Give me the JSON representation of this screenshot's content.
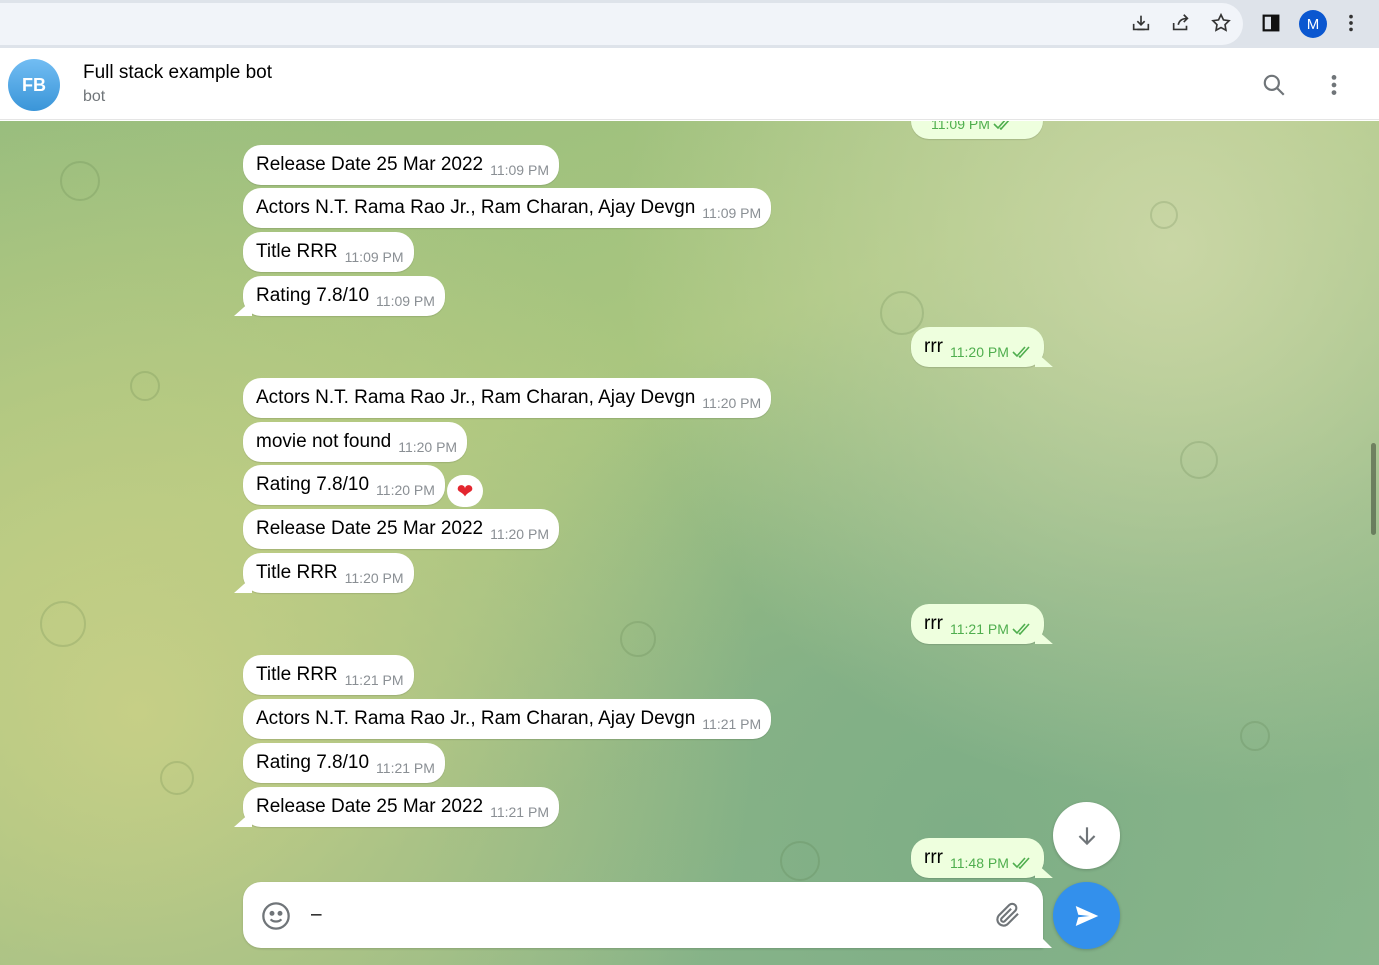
{
  "browser": {
    "profile_initial": "M",
    "icons": [
      "install-icon",
      "share-icon",
      "star-icon",
      "side-panel-icon",
      "kebab-menu-icon"
    ]
  },
  "chat": {
    "avatar_initials": "FB",
    "title": "Full stack example bot",
    "subtitle": "bot"
  },
  "messages": {
    "m0": {
      "time": "11:09 PM"
    },
    "m1": {
      "text": "Release Date 25 Mar 2022",
      "time": "11:09 PM"
    },
    "m2": {
      "text": "Actors N.T. Rama Rao Jr., Ram Charan, Ajay Devgn",
      "time": "11:09 PM"
    },
    "m3": {
      "text": "Title RRR",
      "time": "11:09 PM"
    },
    "m4": {
      "text": "Rating 7.8/10",
      "time": "11:09 PM"
    },
    "m5": {
      "text": "rrr",
      "time": "11:20 PM"
    },
    "m6": {
      "text": "Actors N.T. Rama Rao Jr., Ram Charan, Ajay Devgn",
      "time": "11:20 PM"
    },
    "m7": {
      "text": "movie not found",
      "time": "11:20 PM"
    },
    "m8": {
      "text": "Rating 7.8/10",
      "time": "11:20 PM",
      "reaction": "❤"
    },
    "m9": {
      "text": "Release Date 25 Mar 2022",
      "time": "11:20 PM"
    },
    "m10": {
      "text": "Title RRR",
      "time": "11:20 PM"
    },
    "m11": {
      "text": "rrr",
      "time": "11:21 PM"
    },
    "m12": {
      "text": "Title RRR",
      "time": "11:21 PM"
    },
    "m13": {
      "text": "Actors N.T. Rama Rao Jr., Ram Charan, Ajay Devgn",
      "time": "11:21 PM"
    },
    "m14": {
      "text": "Rating 7.8/10",
      "time": "11:21 PM"
    },
    "m15": {
      "text": "Release Date 25 Mar 2022",
      "time": "11:21 PM"
    },
    "m16": {
      "text": "rrr",
      "time": "11:48 PM"
    }
  },
  "composer": {
    "value": "–"
  },
  "colors": {
    "accent": "#3390ec",
    "outgoing_bubble": "#eeffde",
    "read_check": "#4fae4e",
    "reaction_heart": "#e3262f"
  }
}
